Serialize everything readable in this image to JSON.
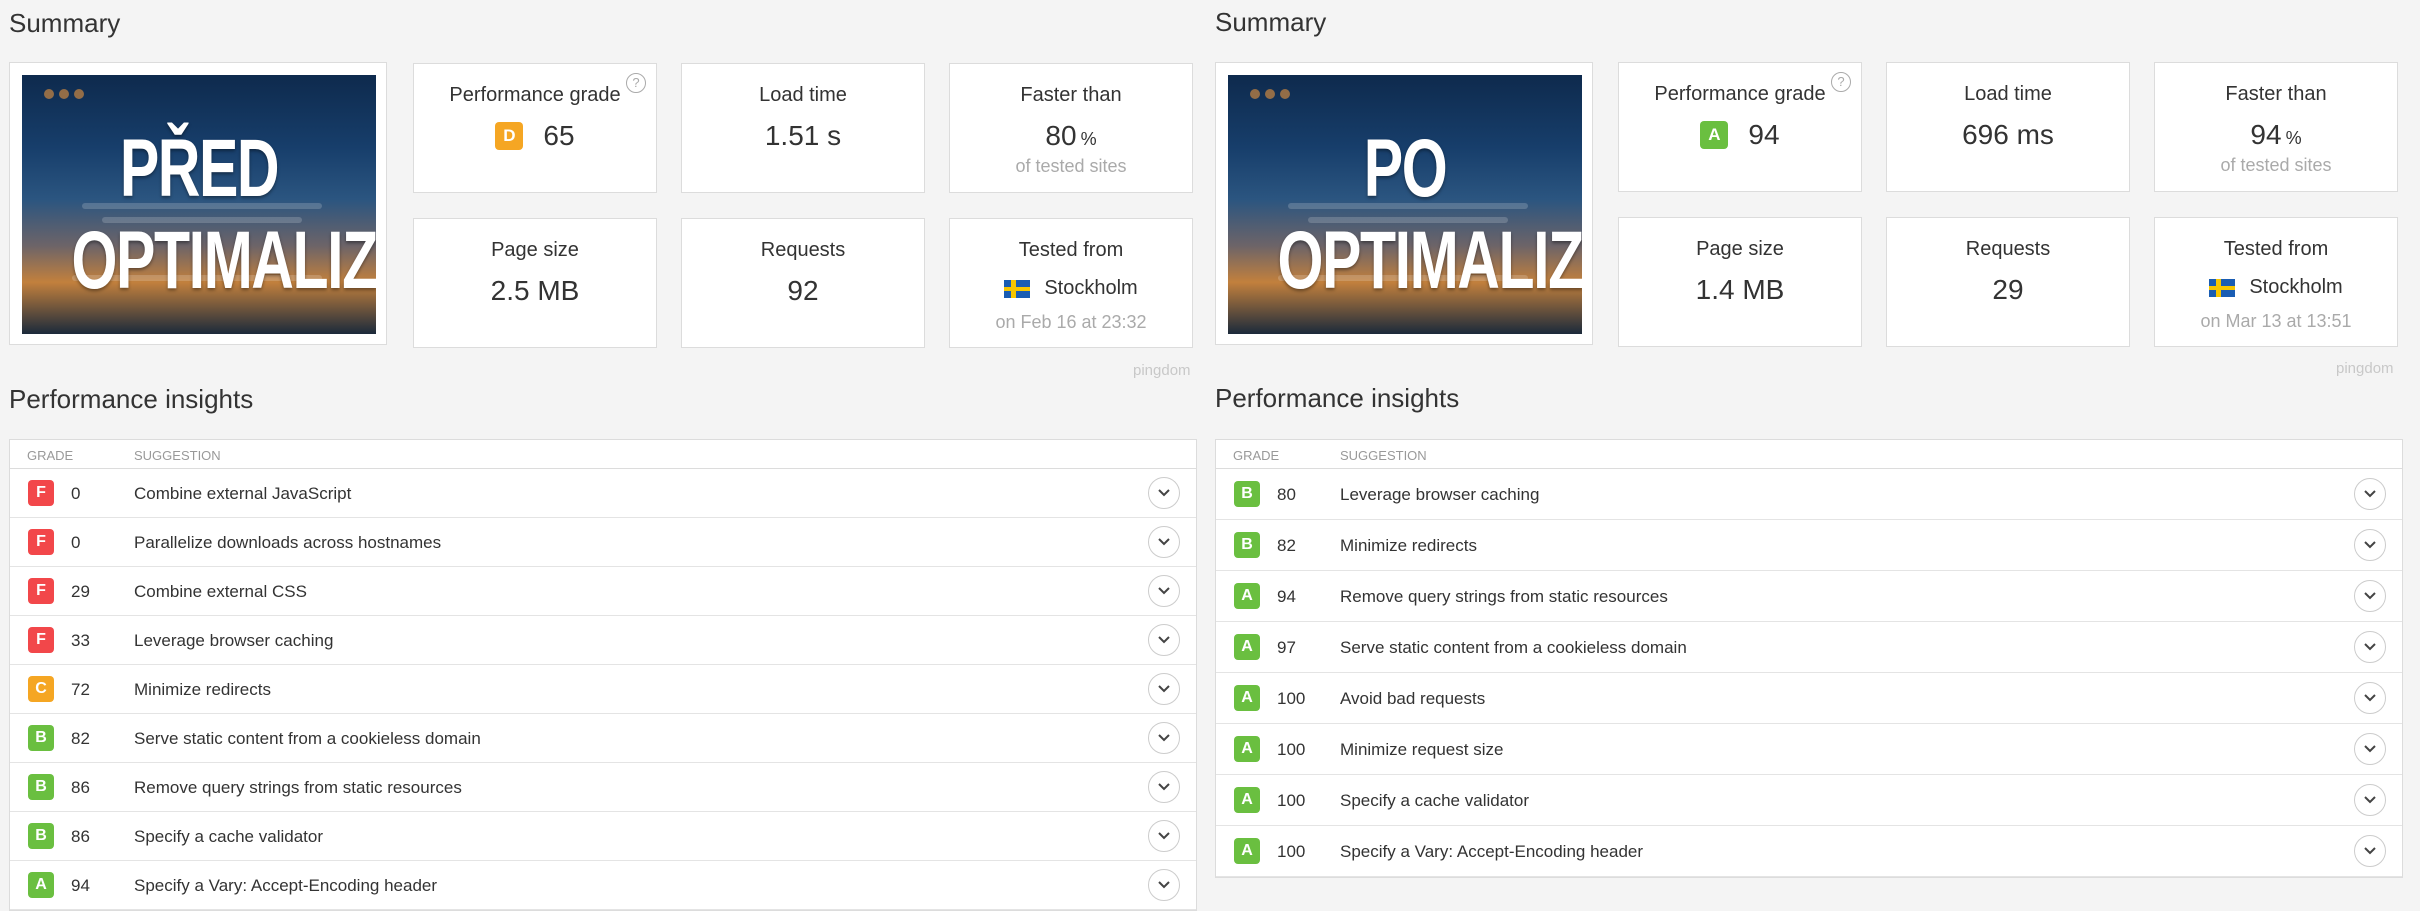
{
  "colors": {
    "F": "#f2474a",
    "C": "#f5a623",
    "D": "#f5a623",
    "B": "#6abf40",
    "A": "#6abf40"
  },
  "left": {
    "summary_title": "Summary",
    "thumbnail": {
      "line1": "PŘED",
      "line2": "OPTIMALIZACÍ"
    },
    "performance_grade": {
      "label": "Performance grade",
      "help": "?",
      "grade": "D",
      "value": "65"
    },
    "load_time": {
      "label": "Load time",
      "value": "1.51 s"
    },
    "faster_than": {
      "label": "Faster than",
      "value": "80",
      "unit": "%",
      "subtext": "of tested sites"
    },
    "page_size": {
      "label": "Page size",
      "value": "2.5 MB"
    },
    "requests": {
      "label": "Requests",
      "value": "92"
    },
    "tested_from": {
      "label": "Tested from",
      "location": "Stockholm",
      "date": "on Feb 16 at 23:32"
    },
    "brand": "pingdom",
    "insights_title": "Performance insights",
    "table": {
      "col_grade": "GRADE",
      "col_suggestion": "SUGGESTION",
      "rows": [
        {
          "grade": "F",
          "score": "0",
          "suggestion": "Combine external JavaScript"
        },
        {
          "grade": "F",
          "score": "0",
          "suggestion": "Parallelize downloads across hostnames"
        },
        {
          "grade": "F",
          "score": "29",
          "suggestion": "Combine external CSS"
        },
        {
          "grade": "F",
          "score": "33",
          "suggestion": "Leverage browser caching"
        },
        {
          "grade": "C",
          "score": "72",
          "suggestion": "Minimize redirects"
        },
        {
          "grade": "B",
          "score": "82",
          "suggestion": "Serve static content from a cookieless domain"
        },
        {
          "grade": "B",
          "score": "86",
          "suggestion": "Remove query strings from static resources"
        },
        {
          "grade": "B",
          "score": "86",
          "suggestion": "Specify a cache validator"
        },
        {
          "grade": "A",
          "score": "94",
          "suggestion": "Specify a Vary: Accept-Encoding header"
        }
      ]
    }
  },
  "right": {
    "summary_title": "Summary",
    "thumbnail": {
      "line1": "PO",
      "line2": "OPTIMALIZACI"
    },
    "performance_grade": {
      "label": "Performance grade",
      "help": "?",
      "grade": "A",
      "value": "94"
    },
    "load_time": {
      "label": "Load time",
      "value": "696 ms"
    },
    "faster_than": {
      "label": "Faster than",
      "value": "94",
      "unit": "%",
      "subtext": "of tested sites"
    },
    "page_size": {
      "label": "Page size",
      "value": "1.4 MB"
    },
    "requests": {
      "label": "Requests",
      "value": "29"
    },
    "tested_from": {
      "label": "Tested from",
      "location": "Stockholm",
      "date": "on Mar 13 at 13:51"
    },
    "brand": "pingdom",
    "insights_title": "Performance insights",
    "table": {
      "col_grade": "GRADE",
      "col_suggestion": "SUGGESTION",
      "rows": [
        {
          "grade": "B",
          "score": "80",
          "suggestion": "Leverage browser caching"
        },
        {
          "grade": "B",
          "score": "82",
          "suggestion": "Minimize redirects"
        },
        {
          "grade": "A",
          "score": "94",
          "suggestion": "Remove query strings from static resources"
        },
        {
          "grade": "A",
          "score": "97",
          "suggestion": "Serve static content from a cookieless domain"
        },
        {
          "grade": "A",
          "score": "100",
          "suggestion": "Avoid bad requests"
        },
        {
          "grade": "A",
          "score": "100",
          "suggestion": "Minimize request size"
        },
        {
          "grade": "A",
          "score": "100",
          "suggestion": "Specify a cache validator"
        },
        {
          "grade": "A",
          "score": "100",
          "suggestion": "Specify a Vary: Accept-Encoding header"
        }
      ]
    }
  }
}
